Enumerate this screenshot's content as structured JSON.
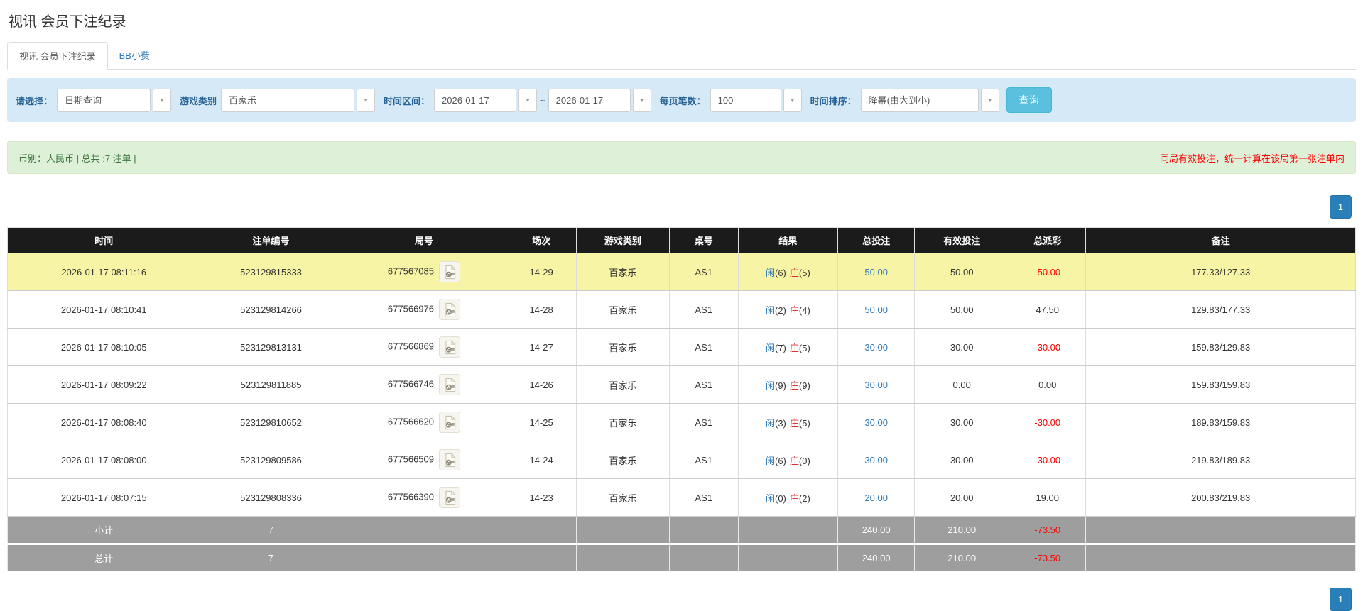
{
  "page_title": "视讯 会员下注纪录",
  "tabs": [
    {
      "label": "视讯 会员下注纪录"
    },
    {
      "label": "BB小费"
    }
  ],
  "filters": {
    "select_label": "请选择：",
    "select_value": "日期查询",
    "game_type_label": "游戏类别",
    "game_type_value": "百家乐",
    "date_range_label": "时间区间：",
    "date_from": "2026-01-17",
    "date_separator": "~",
    "date_to": "2026-01-17",
    "page_size_label": "每页笔数：",
    "page_size_value": "100",
    "sort_label": "时间排序：",
    "sort_value": "降幂(由大到小)",
    "search_button": "查询",
    "caret": "▼"
  },
  "summary": {
    "left": "币别：人民币 | 总共 :7 注单 |",
    "right_notice": "同局有效投注，统一计算在该局第一张注单内"
  },
  "pagination": {
    "top": "1",
    "bottom": "1"
  },
  "table": {
    "columns": [
      "时间",
      "注单编号",
      "局号",
      "场次",
      "游戏类别",
      "桌号",
      "结果",
      "总投注",
      "有效投注",
      "总派彩",
      "备注"
    ],
    "rows": [
      {
        "time": "2026-01-17 08:11:16",
        "bet_id": "523129815333",
        "round_id": "677567085",
        "session": "14-29",
        "game_type": "百家乐",
        "table_no": "AS1",
        "result": {
          "p": "闲",
          "pv": "(6)",
          "b": "庄",
          "bv": "(5)"
        },
        "total_bet": "50.00",
        "valid_bet": "50.00",
        "payout": "-50.00",
        "payout_neg": "true",
        "remark": "177.33/127.33",
        "highlighted": "true"
      },
      {
        "time": "2026-01-17 08:10:41",
        "bet_id": "523129814266",
        "round_id": "677566976",
        "session": "14-28",
        "game_type": "百家乐",
        "table_no": "AS1",
        "result": {
          "p": "闲",
          "pv": "(2)",
          "b": "庄",
          "bv": "(4)"
        },
        "total_bet": "50.00",
        "valid_bet": "50.00",
        "payout": "47.50",
        "payout_neg": "false",
        "remark": "129.83/177.33",
        "highlighted": "false"
      },
      {
        "time": "2026-01-17 08:10:05",
        "bet_id": "523129813131",
        "round_id": "677566869",
        "session": "14-27",
        "game_type": "百家乐",
        "table_no": "AS1",
        "result": {
          "p": "闲",
          "pv": "(7)",
          "b": "庄",
          "bv": "(5)"
        },
        "total_bet": "30.00",
        "valid_bet": "30.00",
        "payout": "-30.00",
        "payout_neg": "true",
        "remark": "159.83/129.83",
        "highlighted": "false"
      },
      {
        "time": "2026-01-17 08:09:22",
        "bet_id": "523129811885",
        "round_id": "677566746",
        "session": "14-26",
        "game_type": "百家乐",
        "table_no": "AS1",
        "result": {
          "p": "闲",
          "pv": "(9)",
          "b": "庄",
          "bv": "(9)"
        },
        "total_bet": "30.00",
        "valid_bet": "0.00",
        "payout": "0.00",
        "payout_neg": "false",
        "remark": "159.83/159.83",
        "highlighted": "false"
      },
      {
        "time": "2026-01-17 08:08:40",
        "bet_id": "523129810652",
        "round_id": "677566620",
        "session": "14-25",
        "game_type": "百家乐",
        "table_no": "AS1",
        "result": {
          "p": "闲",
          "pv": "(3)",
          "b": "庄",
          "bv": "(5)"
        },
        "total_bet": "30.00",
        "valid_bet": "30.00",
        "payout": "-30.00",
        "payout_neg": "true",
        "remark": "189.83/159.83",
        "highlighted": "false"
      },
      {
        "time": "2026-01-17 08:08:00",
        "bet_id": "523129809586",
        "round_id": "677566509",
        "session": "14-24",
        "game_type": "百家乐",
        "table_no": "AS1",
        "result": {
          "p": "闲",
          "pv": "(6)",
          "b": "庄",
          "bv": "(0)"
        },
        "total_bet": "30.00",
        "valid_bet": "30.00",
        "payout": "-30.00",
        "payout_neg": "true",
        "remark": "219.83/189.83",
        "highlighted": "false"
      },
      {
        "time": "2026-01-17 08:07:15",
        "bet_id": "523129808336",
        "round_id": "677566390",
        "session": "14-23",
        "game_type": "百家乐",
        "table_no": "AS1",
        "result": {
          "p": "闲",
          "pv": "(0)",
          "b": "庄",
          "bv": "(2)"
        },
        "total_bet": "20.00",
        "valid_bet": "20.00",
        "payout": "19.00",
        "payout_neg": "false",
        "remark": "200.83/219.83",
        "highlighted": "false"
      }
    ],
    "subtotal": {
      "label": "小计",
      "count": "7",
      "total_bet": "240.00",
      "valid_bet": "210.00",
      "payout": "-73.50",
      "payout_neg": "true"
    },
    "total": {
      "label": "总计",
      "count": "7",
      "total_bet": "240.00",
      "valid_bet": "210.00",
      "payout": "-73.50",
      "payout_neg": "true"
    }
  },
  "colors": {
    "accent_blue": "#337ab7",
    "player_blue": "#337ab7",
    "banker_red": "#e03131",
    "negative_red": "#ff0000",
    "highlight_yellow": "#f7f5a5",
    "header_black": "#1b1b1b",
    "totals_gray": "#9e9e9e",
    "filter_bar_blue": "#d5eaf6",
    "summary_green_bg": "#dff0d8",
    "summary_green_text": "#3c763d",
    "search_button_blue": "#5bc0de",
    "pagination_blue": "#2980b9"
  }
}
